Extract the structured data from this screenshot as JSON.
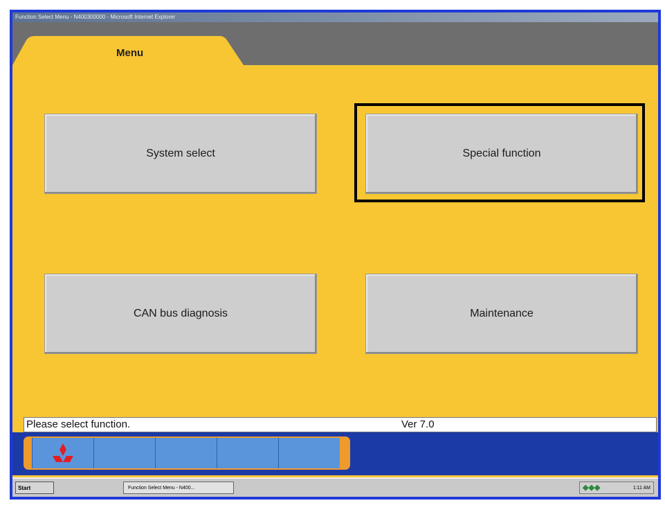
{
  "window": {
    "title": "Function Select Menu - N400300000 - Microsoft Internet Explorer"
  },
  "tab": {
    "label": "Menu"
  },
  "menu": {
    "system_select": "System select",
    "special_function": "Special function",
    "can_bus_diagnosis": "CAN bus diagnosis",
    "maintenance": "Maintenance"
  },
  "status": {
    "message": "Please select function.",
    "version": "Ver 7.0"
  },
  "taskbar": {
    "start_label": "Start",
    "task_item": "Function Select Menu - N400...",
    "clock": "1:11 AM"
  },
  "icons": {
    "brand": "mitsubishi-logo-icon",
    "tray": "tray-icons"
  },
  "colors": {
    "background": "#f7c632",
    "border": "#1f3ad8",
    "bottom_bar": "#1b3aa6",
    "strip": "#ef9a2c"
  }
}
